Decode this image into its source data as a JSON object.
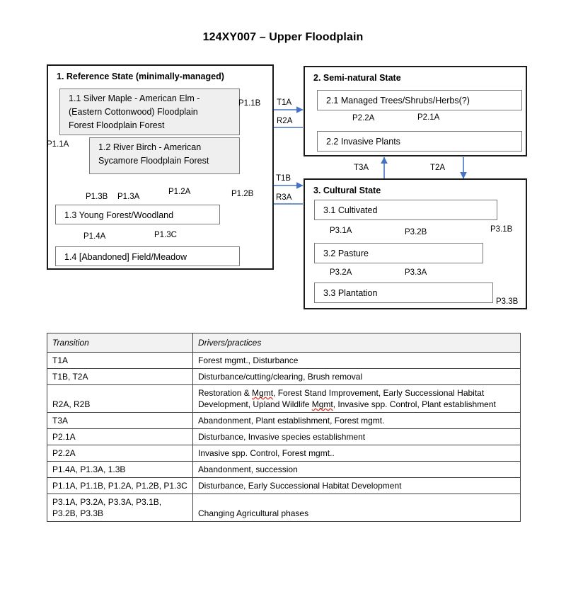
{
  "title": "124XY007 – Upper Floodplain",
  "states": [
    {
      "id": "state-1",
      "heading": "1.  Reference State (minimally-managed)",
      "phases": [
        {
          "id": "phase-1-1",
          "label": "1.1  Silver Maple - American Elm -\n(Eastern Cottonwood)  Floodplain\nForest Floodplain Forest"
        },
        {
          "id": "phase-1-2",
          "label": "1.2  River Birch - American\nSycamore Floodplain Forest"
        },
        {
          "id": "phase-1-3",
          "label": "1.3  Young Forest/Woodland"
        },
        {
          "id": "phase-1-4",
          "label": "1.4  [Abandoned] Field/Meadow"
        }
      ]
    },
    {
      "id": "state-2",
      "heading": "2.  Semi-natural State",
      "phases": [
        {
          "id": "phase-2-1",
          "label": "2.1  Managed Trees/Shrubs/Herbs(?)"
        },
        {
          "id": "phase-2-2",
          "label": "2.2  Invasive Plants"
        }
      ]
    },
    {
      "id": "state-3",
      "heading": "3.  Cultural State",
      "phases": [
        {
          "id": "phase-3-1",
          "label": "3.1  Cultivated"
        },
        {
          "id": "phase-3-2",
          "label": "3.2  Pasture"
        },
        {
          "id": "phase-3-3",
          "label": "3.3  Plantation"
        }
      ]
    }
  ],
  "arrow_labels": {
    "p1_1a": "P1.1A",
    "p1_1b": "P1.1B",
    "p1_3b": "P1.3B",
    "p1_3a": "P1.3A",
    "p1_2a": "P1.2A",
    "p1_2b": "P1.2B",
    "p1_4a": "P1.4A",
    "p1_3c": "P1.3C",
    "t1a": "T1A",
    "r2a": "R2A",
    "t1b": "T1B",
    "r3a": "R3A",
    "t3a": "T3A",
    "t2a": "T2A",
    "p2_2a": "P2.2A",
    "p2_1a": "P2.1A",
    "p3_1a": "P3.1A",
    "p3_2b": "P3.2B",
    "p3_1b": "P3.1B",
    "p3_2a": "P3.2A",
    "p3_3a": "P3.3A",
    "p3_3b": "P3.3B"
  },
  "colors": {
    "arrow": "#4472C4",
    "state_border": "#1a1a1a",
    "phase_border": "#7a7a7a",
    "phase_shaded_fill": "#efefef",
    "table_header_fill": "#f2f2f2",
    "spellcheck_underline": "#e03020"
  },
  "table": {
    "headers": [
      "Transition",
      "Drivers/practices"
    ],
    "rows": [
      {
        "transition": "T1A",
        "drivers": "Forest mgmt., Disturbance"
      },
      {
        "transition": "T1B, T2A",
        "drivers": "Disturbance/cutting/clearing, Brush removal"
      },
      {
        "transition": "R2A, R2B",
        "drivers": "Restoration & Mgmt, Forest Stand Improvement, Early Successional Habitat Development, Upland Wildlife Mgmt, Invasive spp. Control, Plant establishment"
      },
      {
        "transition": "T3A",
        "drivers": "Abandonment,  Plant establishment, Forest mgmt."
      },
      {
        "transition": "P2.1A",
        "drivers": "Disturbance, Invasive species establishment"
      },
      {
        "transition": "P2.2A",
        "drivers": "Invasive spp. Control, Forest mgmt.."
      },
      {
        "transition": "P1.4A, P1.3A, 1.3B",
        "drivers": "Abandonment,  succession"
      },
      {
        "transition": "P1.1A, P1.1B, P1.2A, P1.2B, P1.3C",
        "drivers": "Disturbance, Early Successional Habitat Development"
      },
      {
        "transition": "P3.1A, P3.2A, P3.3A, P3.1B, P3.2B, P3.3B",
        "drivers": "Changing Agricultural phases"
      }
    ]
  }
}
